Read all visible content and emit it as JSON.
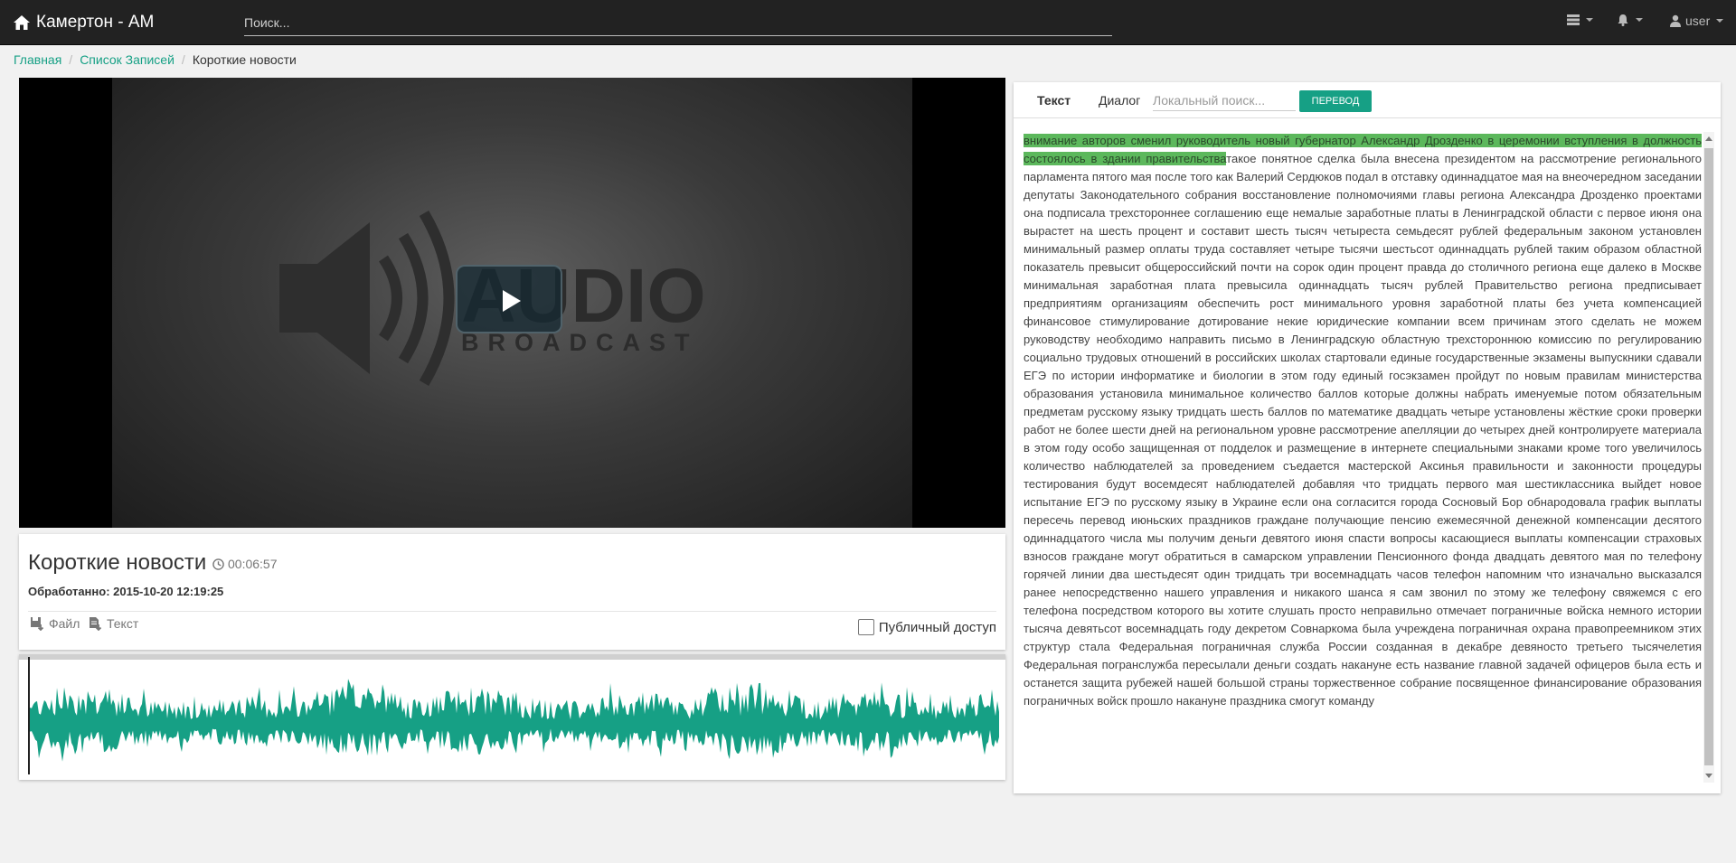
{
  "navbar": {
    "brand": "Камертон - АМ",
    "search_placeholder": "Поиск...",
    "user_label": "user",
    "icons": [
      "home-icon",
      "list-icon",
      "bell-icon",
      "user-icon"
    ]
  },
  "breadcrumb": {
    "items": [
      "Главная",
      "Список Записей"
    ],
    "current": "Короткие новости",
    "separator": "/"
  },
  "player": {
    "art_title": "AUDIO",
    "art_subtitle": "BROADCAST"
  },
  "record": {
    "title": "Короткие новости",
    "duration": "00:06:57",
    "processed": "Обработанно: 2015-10-20 12:19:25",
    "file_label": "Файл",
    "text_label": "Текст",
    "public_label": "Публичный доступ"
  },
  "transcript": {
    "tab_text": "Текст",
    "tab_dialog": "Диалог",
    "search_placeholder": "Локальный поиск...",
    "translate_label": "ПЕРЕВОД",
    "highlighted": "внимание авторов сменил руководитель новый губернатор Александр Дрозденко в церемонии вступления в должность состоялось в здании правительства",
    "body": "такое понятное сделка была внесена президентом на рассмотрение регионального парламента пятого мая после того как Валерий Сердюков подал в отставку одиннадцатое мая на внеочередном заседании депутаты Законодательного собрания восстановление полномочиями главы региона Александра Дрозденко проектами она подписала трехстороннее соглашению еще немалые заработные платы в Ленинградской области с первое июня она вырастет на шесть процент и составит шесть тысяч четыреста семьдесят рублей федеральным законом установлен минимальный размер оплаты труда составляет четыре тысячи шестьсот одиннадцать рублей таким образом областной показатель превысит общероссийский почти на сорок один процент правда до столичного региона еще далеко в Москве минимальная заработная плата превысила одиннадцать тысяч рублей Правительство региона предписывает предприятиям организациям обеспечить рост минимального уровня заработной платы без учета компенсацией финансовое стимулирование дотирование некие юридические компании всем причинам этого сделать не можем руководству необходимо направить письмо в Ленинградскую областную трехстороннюю комиссию по регулированию социально трудовых отношений в российских школах стартовали единые государственные экзамены выпускники сдавали ЕГЭ по истории информатике и биологии в этом году единый госэкзамен пройдут по новым правилам министерства образования установила минимальное количество баллов которые должны набрать именуемые потом обязательным предметам русскому языку тридцать шесть баллов по математике двадцать четыре установлены жёсткие сроки проверки работ не более шести дней на региональном уровне рассмотрение апелляции до четырех дней контролируете материала в этом году особо защищенная от подделок и размещение в интернете специальными знаками кроме того увеличилось количество наблюдателей за проведением съедается мастерской Аксинья правильности и законности процедуры тестирования будут восемдесят наблюдателей добавляя что тридцать первого мая шестиклассника выйдет новое испытание ЕГЭ по русскому языку в Украине если она согласится города Сосновый Бор обнародовала график выплаты пересечь перевод июньских праздников граждане получающие пенсию ежемесячной денежной компенсации десятого одиннадцатого числа мы получим деньги девятого июня спасти вопросы касающиеся выплаты компенсации страховых взносов граждане могут обратиться в самарском управлении Пенсионного фонда двадцать девятого мая по телефону горячей линии два шестьдесят один тридцать три восемнадцать часов телефон напомним что изначально высказался ранее непосредственно нашего управления и никакого шанса я сам звонил по этому же телефону свяжемся с его телефона посредством которого вы хотите слушать просто неправильно отмечает пограничные войска немного истории тысяча девятьсот восемнадцать году декретом Совнаркома была учреждена пограничная охрана правопреемником этих структур стала Федеральная пограничная служба России созданная в декабре девяносто третьего тысячелетия Федеральная погранслужба пересылали деньги создать накануне есть название главной задачей офицеров была есть и останется защита рубежей нашей большой страны торжественное собрание посвященное финансирование образования пограничных войск прошло накануне праздника смогут команду"
  },
  "colors": {
    "accent": "#16a085",
    "highlight": "#5cb85c",
    "waveform": "#16a085",
    "navbar": "#222222"
  }
}
